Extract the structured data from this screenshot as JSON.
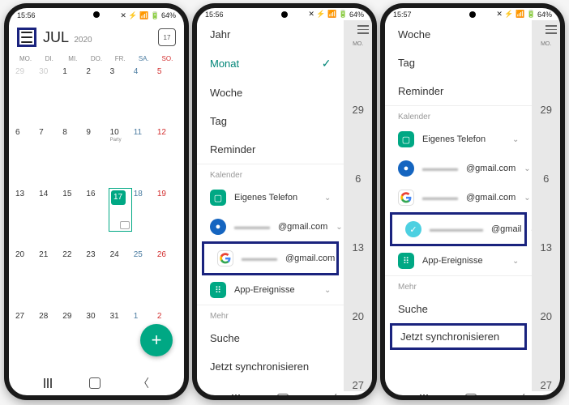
{
  "status": {
    "time1": "15:56",
    "time2": "15:56",
    "time3": "15:57",
    "battery": "64%",
    "icons": "✕ ⚡ 📶 🔋"
  },
  "cal": {
    "month": "JUL",
    "year": "2020",
    "today_num": "17",
    "weekdays": [
      "MO.",
      "DI.",
      "MI.",
      "DO.",
      "FR.",
      "SA.",
      "SO."
    ],
    "event_label": "Party",
    "grid": [
      [
        "29",
        "30",
        "1",
        "2",
        "3",
        "4",
        "5"
      ],
      [
        "6",
        "7",
        "8",
        "9",
        "10",
        "11",
        "12"
      ],
      [
        "13",
        "14",
        "15",
        "16",
        "17",
        "18",
        "19"
      ],
      [
        "20",
        "21",
        "22",
        "23",
        "24",
        "25",
        "26"
      ],
      [
        "27",
        "28",
        "29",
        "30",
        "31",
        "1",
        "2"
      ]
    ]
  },
  "drawer": {
    "views": {
      "jahr": "Jahr",
      "monat": "Monat",
      "woche": "Woche",
      "tag": "Tag",
      "reminder": "Reminder"
    },
    "sec_kalender": "Kalender",
    "eigenes": "Eigenes Telefon",
    "gmail1": "@gmail.com",
    "gmail2": "@gmail.com",
    "gmail3": "@gmail",
    "app_ereignisse": "App-Ereignisse",
    "sec_mehr": "Mehr",
    "suche": "Suche",
    "sync": "Jetzt synchronisieren"
  },
  "datecol": {
    "label": "MO.",
    "days": [
      "29",
      "6",
      "13",
      "20",
      "27"
    ]
  }
}
